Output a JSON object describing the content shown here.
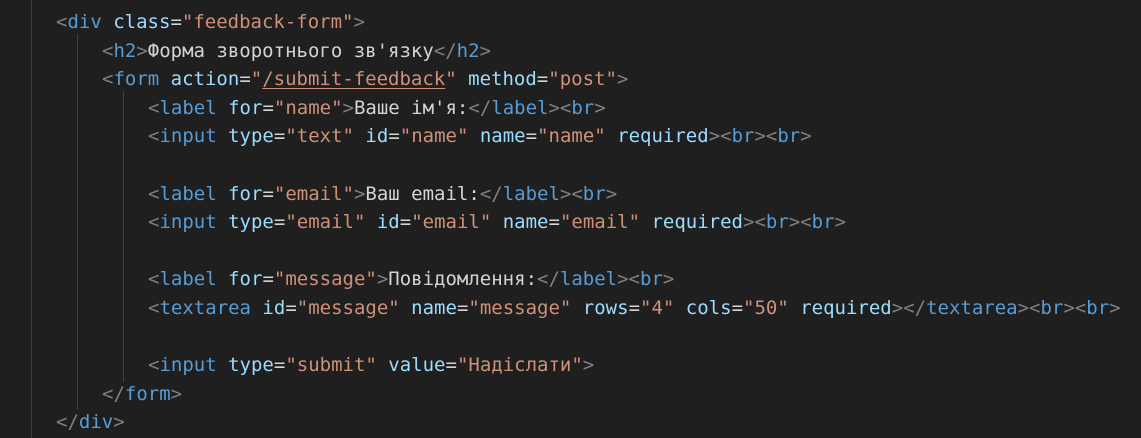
{
  "editor": {
    "background": "#1f1f1f",
    "colors": {
      "bracket": "#808080",
      "tag": "#569cd6",
      "attribute": "#9cdcfe",
      "string": "#ce9178",
      "text": "#d4d4d4"
    },
    "lines": [
      {
        "indent": 1,
        "tokens": [
          {
            "t": "bracket",
            "v": "<"
          },
          {
            "t": "tag",
            "v": "div"
          },
          {
            "t": "text",
            "v": " "
          },
          {
            "t": "attr",
            "v": "class"
          },
          {
            "t": "eq",
            "v": "="
          },
          {
            "t": "str",
            "v": "\"feedback-form\""
          },
          {
            "t": "bracket",
            "v": ">"
          }
        ]
      },
      {
        "indent": 2,
        "tokens": [
          {
            "t": "bracket",
            "v": "<"
          },
          {
            "t": "tag",
            "v": "h2"
          },
          {
            "t": "bracket",
            "v": ">"
          },
          {
            "t": "text",
            "v": "Форма зворотнього зв'язку"
          },
          {
            "t": "bracket",
            "v": "</"
          },
          {
            "t": "tag",
            "v": "h2"
          },
          {
            "t": "bracket",
            "v": ">"
          }
        ]
      },
      {
        "indent": 2,
        "tokens": [
          {
            "t": "bracket",
            "v": "<"
          },
          {
            "t": "tag",
            "v": "form"
          },
          {
            "t": "text",
            "v": " "
          },
          {
            "t": "attr",
            "v": "action"
          },
          {
            "t": "eq",
            "v": "="
          },
          {
            "t": "str",
            "v": "\""
          },
          {
            "t": "str",
            "v": "/submit-feedback",
            "link": true
          },
          {
            "t": "str",
            "v": "\""
          },
          {
            "t": "text",
            "v": " "
          },
          {
            "t": "attr",
            "v": "method"
          },
          {
            "t": "eq",
            "v": "="
          },
          {
            "t": "str",
            "v": "\"post\""
          },
          {
            "t": "bracket",
            "v": ">"
          }
        ]
      },
      {
        "indent": 3,
        "tokens": [
          {
            "t": "bracket",
            "v": "<"
          },
          {
            "t": "tag",
            "v": "label"
          },
          {
            "t": "text",
            "v": " "
          },
          {
            "t": "attr",
            "v": "for"
          },
          {
            "t": "eq",
            "v": "="
          },
          {
            "t": "str",
            "v": "\"name\""
          },
          {
            "t": "bracket",
            "v": ">"
          },
          {
            "t": "text",
            "v": "Ваше ім'я:"
          },
          {
            "t": "bracket",
            "v": "</"
          },
          {
            "t": "tag",
            "v": "label"
          },
          {
            "t": "bracket",
            "v": "><"
          },
          {
            "t": "tag",
            "v": "br"
          },
          {
            "t": "bracket",
            "v": ">"
          }
        ]
      },
      {
        "indent": 3,
        "tokens": [
          {
            "t": "bracket",
            "v": "<"
          },
          {
            "t": "tag",
            "v": "input"
          },
          {
            "t": "text",
            "v": " "
          },
          {
            "t": "attr",
            "v": "type"
          },
          {
            "t": "eq",
            "v": "="
          },
          {
            "t": "str",
            "v": "\"text\""
          },
          {
            "t": "text",
            "v": " "
          },
          {
            "t": "attr",
            "v": "id"
          },
          {
            "t": "eq",
            "v": "="
          },
          {
            "t": "str",
            "v": "\"name\""
          },
          {
            "t": "text",
            "v": " "
          },
          {
            "t": "attr",
            "v": "name"
          },
          {
            "t": "eq",
            "v": "="
          },
          {
            "t": "str",
            "v": "\"name\""
          },
          {
            "t": "text",
            "v": " "
          },
          {
            "t": "attr",
            "v": "required"
          },
          {
            "t": "bracket",
            "v": "><"
          },
          {
            "t": "tag",
            "v": "br"
          },
          {
            "t": "bracket",
            "v": "><"
          },
          {
            "t": "tag",
            "v": "br"
          },
          {
            "t": "bracket",
            "v": ">"
          }
        ]
      },
      {
        "indent": 3,
        "tokens": []
      },
      {
        "indent": 3,
        "tokens": [
          {
            "t": "bracket",
            "v": "<"
          },
          {
            "t": "tag",
            "v": "label"
          },
          {
            "t": "text",
            "v": " "
          },
          {
            "t": "attr",
            "v": "for"
          },
          {
            "t": "eq",
            "v": "="
          },
          {
            "t": "str",
            "v": "\"email\""
          },
          {
            "t": "bracket",
            "v": ">"
          },
          {
            "t": "text",
            "v": "Ваш email:"
          },
          {
            "t": "bracket",
            "v": "</"
          },
          {
            "t": "tag",
            "v": "label"
          },
          {
            "t": "bracket",
            "v": "><"
          },
          {
            "t": "tag",
            "v": "br"
          },
          {
            "t": "bracket",
            "v": ">"
          }
        ]
      },
      {
        "indent": 3,
        "tokens": [
          {
            "t": "bracket",
            "v": "<"
          },
          {
            "t": "tag",
            "v": "input"
          },
          {
            "t": "text",
            "v": " "
          },
          {
            "t": "attr",
            "v": "type"
          },
          {
            "t": "eq",
            "v": "="
          },
          {
            "t": "str",
            "v": "\"email\""
          },
          {
            "t": "text",
            "v": " "
          },
          {
            "t": "attr",
            "v": "id"
          },
          {
            "t": "eq",
            "v": "="
          },
          {
            "t": "str",
            "v": "\"email\""
          },
          {
            "t": "text",
            "v": " "
          },
          {
            "t": "attr",
            "v": "name"
          },
          {
            "t": "eq",
            "v": "="
          },
          {
            "t": "str",
            "v": "\"email\""
          },
          {
            "t": "text",
            "v": " "
          },
          {
            "t": "attr",
            "v": "required"
          },
          {
            "t": "bracket",
            "v": "><"
          },
          {
            "t": "tag",
            "v": "br"
          },
          {
            "t": "bracket",
            "v": "><"
          },
          {
            "t": "tag",
            "v": "br"
          },
          {
            "t": "bracket",
            "v": ">"
          }
        ]
      },
      {
        "indent": 3,
        "tokens": []
      },
      {
        "indent": 3,
        "tokens": [
          {
            "t": "bracket",
            "v": "<"
          },
          {
            "t": "tag",
            "v": "label"
          },
          {
            "t": "text",
            "v": " "
          },
          {
            "t": "attr",
            "v": "for"
          },
          {
            "t": "eq",
            "v": "="
          },
          {
            "t": "str",
            "v": "\"message\""
          },
          {
            "t": "bracket",
            "v": ">"
          },
          {
            "t": "text",
            "v": "Повідомлення:"
          },
          {
            "t": "bracket",
            "v": "</"
          },
          {
            "t": "tag",
            "v": "label"
          },
          {
            "t": "bracket",
            "v": "><"
          },
          {
            "t": "tag",
            "v": "br"
          },
          {
            "t": "bracket",
            "v": ">"
          }
        ]
      },
      {
        "indent": 3,
        "tokens": [
          {
            "t": "bracket",
            "v": "<"
          },
          {
            "t": "tag",
            "v": "textarea"
          },
          {
            "t": "text",
            "v": " "
          },
          {
            "t": "attr",
            "v": "id"
          },
          {
            "t": "eq",
            "v": "="
          },
          {
            "t": "str",
            "v": "\"message\""
          },
          {
            "t": "text",
            "v": " "
          },
          {
            "t": "attr",
            "v": "name"
          },
          {
            "t": "eq",
            "v": "="
          },
          {
            "t": "str",
            "v": "\"message\""
          },
          {
            "t": "text",
            "v": " "
          },
          {
            "t": "attr",
            "v": "rows"
          },
          {
            "t": "eq",
            "v": "="
          },
          {
            "t": "str",
            "v": "\"4\""
          },
          {
            "t": "text",
            "v": " "
          },
          {
            "t": "attr",
            "v": "cols"
          },
          {
            "t": "eq",
            "v": "="
          },
          {
            "t": "str",
            "v": "\"50\""
          },
          {
            "t": "text",
            "v": " "
          },
          {
            "t": "attr",
            "v": "required"
          },
          {
            "t": "bracket",
            "v": "></"
          },
          {
            "t": "tag",
            "v": "textarea"
          },
          {
            "t": "bracket",
            "v": "><"
          },
          {
            "t": "tag",
            "v": "br"
          },
          {
            "t": "bracket",
            "v": "><"
          },
          {
            "t": "tag",
            "v": "br"
          },
          {
            "t": "bracket",
            "v": ">"
          }
        ]
      },
      {
        "indent": 3,
        "tokens": []
      },
      {
        "indent": 3,
        "tokens": [
          {
            "t": "bracket",
            "v": "<"
          },
          {
            "t": "tag",
            "v": "input"
          },
          {
            "t": "text",
            "v": " "
          },
          {
            "t": "attr",
            "v": "type"
          },
          {
            "t": "eq",
            "v": "="
          },
          {
            "t": "str",
            "v": "\"submit\""
          },
          {
            "t": "text",
            "v": " "
          },
          {
            "t": "attr",
            "v": "value"
          },
          {
            "t": "eq",
            "v": "="
          },
          {
            "t": "str",
            "v": "\"Надіслати\""
          },
          {
            "t": "bracket",
            "v": ">"
          }
        ]
      },
      {
        "indent": 2,
        "tokens": [
          {
            "t": "bracket",
            "v": "</"
          },
          {
            "t": "tag",
            "v": "form"
          },
          {
            "t": "bracket",
            "v": ">"
          }
        ]
      },
      {
        "indent": 1,
        "tokens": [
          {
            "t": "bracket",
            "v": "</"
          },
          {
            "t": "tag",
            "v": "div"
          },
          {
            "t": "bracket",
            "v": ">"
          }
        ]
      }
    ]
  }
}
